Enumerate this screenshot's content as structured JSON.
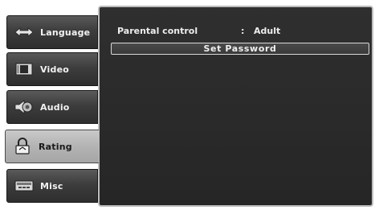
{
  "sidebar": {
    "items": [
      {
        "label": "Language",
        "icon": "language-icon"
      },
      {
        "label": "Video",
        "icon": "video-icon"
      },
      {
        "label": "Audio",
        "icon": "audio-icon"
      },
      {
        "label": "Rating",
        "icon": "rating-icon"
      },
      {
        "label": "Misc",
        "icon": "misc-icon"
      }
    ],
    "active_index": 3
  },
  "panel": {
    "parental_control": {
      "label": "Parental control",
      "separator": ":",
      "value": "Adult"
    },
    "set_password_button": "Set Password"
  }
}
